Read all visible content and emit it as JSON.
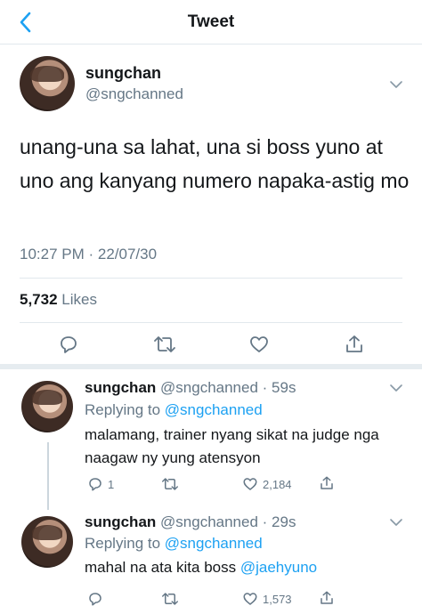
{
  "header": {
    "title": "Tweet"
  },
  "tweet": {
    "name": "sungchan",
    "handle": "@sngchanned",
    "text": "unang-una sa lahat, una si boss yuno at uno ang kanyang numero napaka-astig mo",
    "timestamp": "10:27 PM · 22/07/30",
    "likes_count": "5,732",
    "likes_label": "Likes"
  },
  "replies": [
    {
      "name": "sungchan",
      "meta": "@sngchanned · 59s",
      "replying_label": "Replying to",
      "replying_to": "@sngchanned",
      "text": "malamang, trainer nyang sikat na judge nga naagaw ny yung atensyon",
      "reply_count": "1",
      "like_count": "2,184"
    },
    {
      "name": "sungchan",
      "meta": "@sngchanned · 29s",
      "replying_label": "Replying to",
      "replying_to": "@sngchanned",
      "text_prefix": "mahal na ata kita boss",
      "text_mention": "@jaehyuno",
      "like_count": "1,573"
    }
  ],
  "colors": {
    "accent": "#1da1f2",
    "muted": "#657786",
    "text": "#14171a",
    "border": "#e1e8ed"
  }
}
